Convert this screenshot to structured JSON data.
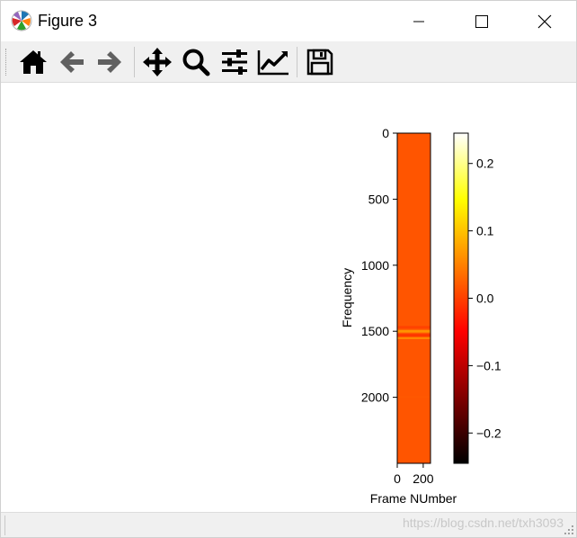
{
  "window": {
    "title": "Figure 3",
    "icon": "matplotlib-logo-icon"
  },
  "toolbar": {
    "items": [
      {
        "name": "home",
        "icon": "home-icon"
      },
      {
        "name": "back",
        "icon": "arrow-left-icon"
      },
      {
        "name": "forward",
        "icon": "arrow-right-icon"
      },
      {
        "name": "pan",
        "icon": "move-icon"
      },
      {
        "name": "zoom",
        "icon": "zoom-icon"
      },
      {
        "name": "subplots",
        "icon": "sliders-icon"
      },
      {
        "name": "edit-axes",
        "icon": "line-chart-icon"
      },
      {
        "name": "save",
        "icon": "save-icon"
      }
    ]
  },
  "chart_data": {
    "type": "heatmap",
    "colormap": "hot",
    "xlabel": "Frame NUmber",
    "ylabel": "Frequency",
    "x_ticks": [
      0,
      200
    ],
    "xlim": [
      0,
      256
    ],
    "y_ticks": [
      0,
      500,
      1000,
      1500,
      2000
    ],
    "ylim": [
      2500,
      0
    ],
    "base_value": 0.02,
    "bands": [
      {
        "y_start": 1460,
        "y_end": 1480,
        "value": -0.02
      },
      {
        "y_start": 1490,
        "y_end": 1510,
        "value": 0.05
      },
      {
        "y_start": 1520,
        "y_end": 1540,
        "value": -0.03
      },
      {
        "y_start": 1545,
        "y_end": 1560,
        "value": 0.04
      },
      {
        "y_start": 1995,
        "y_end": 2002,
        "value": 0.0
      }
    ],
    "colorbar": {
      "ticks": [
        0.2,
        0.1,
        0.0,
        -0.1,
        -0.2
      ],
      "tick_labels": [
        "0.2",
        "0.1",
        "0.0",
        "−0.1",
        "−0.2"
      ],
      "vmin": -0.245,
      "vmax": 0.245,
      "colors": [
        "#000000",
        "#800000",
        "#ff0000",
        "#ff8000",
        "#ffff00",
        "#ffffff"
      ]
    }
  },
  "statusbar": {
    "watermark": "https://blog.csdn.net/txh3093"
  },
  "colors": {
    "heatmap_fill": "#ff5500",
    "toolbar_bg": "#f0f0f0"
  }
}
